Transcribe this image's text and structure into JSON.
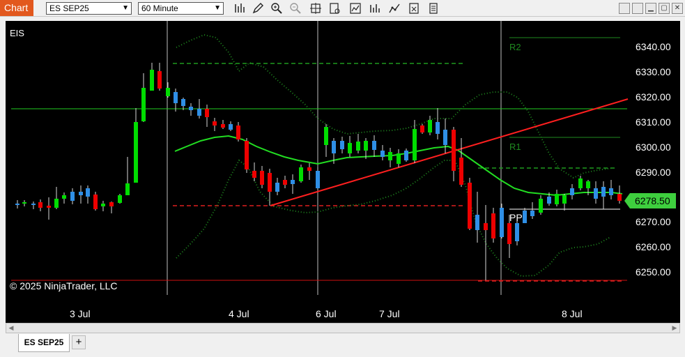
{
  "window": {
    "tag": "Chart",
    "instrument": "ES SEP25",
    "interval": "60 Minute",
    "buttons": [
      "bar-type-icon",
      "pencil-icon",
      "zoom-in-icon",
      "zoom-out-icon",
      "crosshair-icon",
      "data-box-icon",
      "indicators-icon",
      "strategies-icon",
      "templates-icon",
      "properties-icon"
    ]
  },
  "chart": {
    "symbol_label": "EIS",
    "copyright": "© 2025 NinjaTrader, LLC",
    "price_labels": [
      "6340.00",
      "6330.00",
      "6320.00",
      "6310.00",
      "6300.00",
      "6290.00",
      "6270.00",
      "6260.00",
      "6250.00"
    ],
    "current_price": "6278.50",
    "date_labels": [
      "3 Jul",
      "4 Jul",
      "6 Jul",
      "7 Jul",
      "8 Jul"
    ],
    "pivot_labels": {
      "r2": "R2",
      "r1": "R1",
      "pp": "PP"
    },
    "colors": {
      "up": "#00dd00",
      "down": "#ee0000",
      "neutral": "#2f8fe6",
      "price_tag": "#3ecf3e"
    }
  },
  "tabs": {
    "active": "ES SEP25",
    "add": "+"
  }
}
